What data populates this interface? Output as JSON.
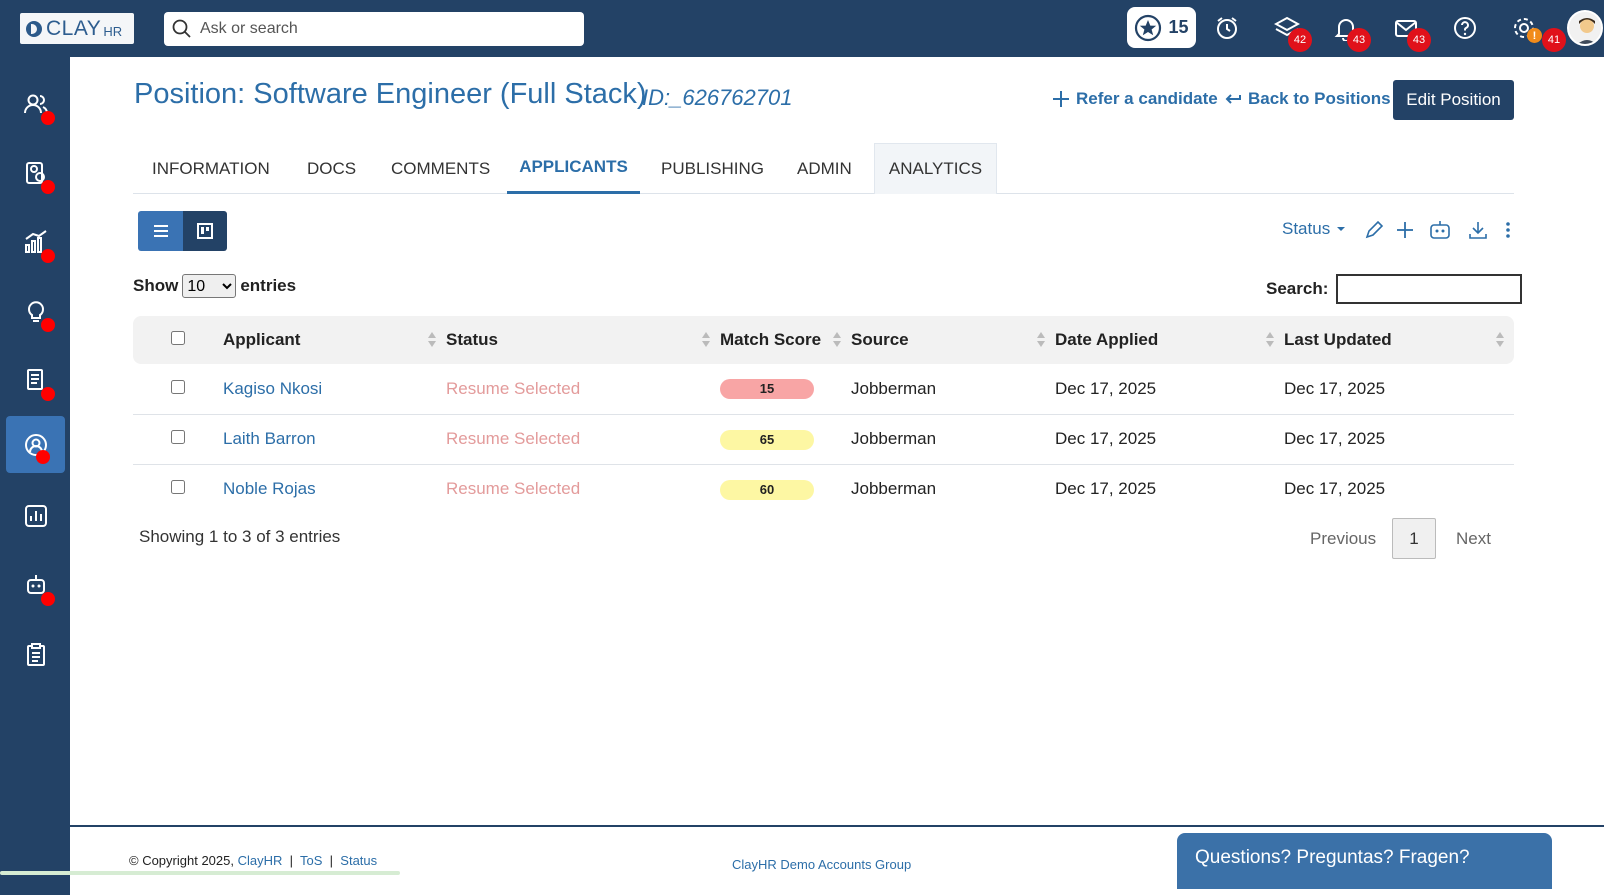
{
  "logo": {
    "word": "CLAY",
    "suffix": "HR"
  },
  "search": {
    "placeholder": "Ask or search"
  },
  "topbar": {
    "stars_count": "15",
    "icons": [
      "alarm-icon",
      "layers-icon",
      "bell-icon",
      "mail-icon",
      "help-icon",
      "settings-icon"
    ],
    "layers_badge": "42",
    "bell_badge": "43",
    "mail_badge": "43",
    "settings_warn": "!",
    "avatar_badge": "41"
  },
  "sidebar": {
    "items": [
      "people-icon",
      "candidate-search-icon",
      "analytics-chart-icon",
      "ideas-icon",
      "documents-icon",
      "applicant-icon",
      "report-icon",
      "robot-icon",
      "checklist-icon"
    ],
    "active_index": 5
  },
  "page": {
    "title": "Position: Software Engineer (Full Stack)",
    "id_label": "ID:_626762701",
    "refer_label": "Refer a candidate",
    "back_label": "Back to Positions",
    "edit_label": "Edit Position"
  },
  "tabs": [
    "INFORMATION",
    "DOCS",
    "COMMENTS",
    "APPLICANTS",
    "PUBLISHING",
    "ADMIN",
    "ANALYTICS"
  ],
  "active_tab": "APPLICANTS",
  "toolbar": {
    "status_label": "Status"
  },
  "table_controls": {
    "show_label": "Show",
    "entries_value": "10",
    "entries_label": "entries",
    "search_label": "Search:"
  },
  "table": {
    "headers": [
      "Applicant",
      "Status",
      "Match Score",
      "Source",
      "Date Applied",
      "Last Updated"
    ],
    "rows": [
      {
        "applicant": "Kagiso Nkosi",
        "status": "Resume Selected",
        "score": "15",
        "source": "Jobberman",
        "date_applied": "Dec 17, 2025",
        "last_updated": "Dec 17, 2025"
      },
      {
        "applicant": "Laith Barron",
        "status": "Resume Selected",
        "score": "65",
        "source": "Jobberman",
        "date_applied": "Dec 17, 2025",
        "last_updated": "Dec 17, 2025"
      },
      {
        "applicant": "Noble Rojas",
        "status": "Resume Selected",
        "score": "60",
        "source": "Jobberman",
        "date_applied": "Dec 17, 2025",
        "last_updated": "Dec 17, 2025"
      }
    ]
  },
  "colors": {
    "score_low": "#f8a5a5",
    "score_mid": "#fdf7a3",
    "brand_navy": "#234266",
    "accent_blue": "#2c6ea8"
  },
  "pagination": {
    "summary": "Showing 1 to 3 of 3 entries",
    "previous": "Previous",
    "current": "1",
    "next": "Next"
  },
  "footer": {
    "copyright": "© Copyright 2025,",
    "brand_link": "ClayHR",
    "sep": "|",
    "tos": "ToS",
    "status": "Status",
    "group": "ClayHR Demo Accounts Group",
    "questions": "Questions? Preguntas? Fragen?"
  }
}
